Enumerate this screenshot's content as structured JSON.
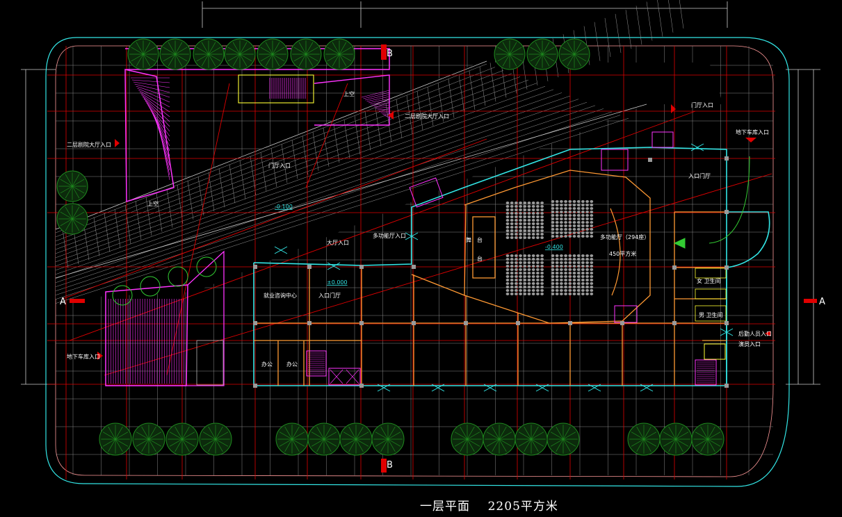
{
  "drawing": {
    "title": "一层平面    2205平方米"
  },
  "labels": {
    "second_floor_hall_entry_left": "二层剧院大厅入口",
    "second_floor_hall_entry_right": "二层剧院大厅入口",
    "lobby_entry_upper": "门厅入口",
    "upper_void_a": "上空",
    "upper_void_b": "上空",
    "level_neg_0100": "-0.100",
    "level_0000": "±0.000",
    "level_neg_0400": "-0.400",
    "hall_entry": "大厅入口",
    "multi_hall_entry": "多功能厅入口",
    "employment_center": "就业咨询中心",
    "entry_foyer_left": "入口门厅",
    "office_1": "办公",
    "office_2": "办公",
    "multi_hall_name": "多功能厅（294座）",
    "multi_hall_area": "450平方米",
    "stage_left": "舞",
    "stage_right": "台",
    "stage_bottom": "台",
    "foyer_entry_top": "门厅入口",
    "basement_garage_entry_right": "地下车库入口",
    "entry_foyer_right": "入口门厅",
    "female_wc": "女 卫生间",
    "male_wc": "男 卫生间",
    "staff_entry": "后勤人员入口",
    "performer_entry": "演员入口",
    "basement_garage_entry_left": "地下车库入口",
    "section_a_left": "A",
    "section_a_right": "A",
    "section_b_top": "B",
    "section_b_bottom": "B"
  },
  "legend_colors": {
    "axis_grid": "#e00000",
    "paving_grid": "#8a8a8a",
    "exterior_wall": "#33e6e6",
    "interior_wall": "#ff9933",
    "ramp_and_stair": "#ff33ff",
    "trees": "#1f8a1f",
    "columns": "#9a9a9a"
  }
}
